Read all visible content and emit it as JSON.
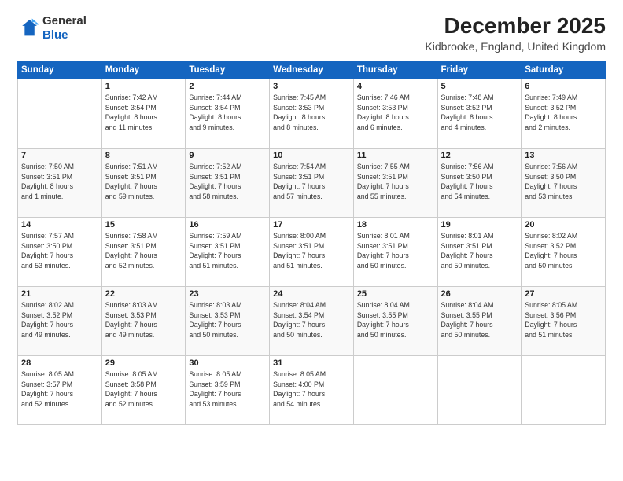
{
  "logo": {
    "general": "General",
    "blue": "Blue"
  },
  "title": "December 2025",
  "location": "Kidbrooke, England, United Kingdom",
  "days_of_week": [
    "Sunday",
    "Monday",
    "Tuesday",
    "Wednesday",
    "Thursday",
    "Friday",
    "Saturday"
  ],
  "weeks": [
    [
      {
        "date": "",
        "info": ""
      },
      {
        "date": "1",
        "info": "Sunrise: 7:42 AM\nSunset: 3:54 PM\nDaylight: 8 hours\nand 11 minutes."
      },
      {
        "date": "2",
        "info": "Sunrise: 7:44 AM\nSunset: 3:54 PM\nDaylight: 8 hours\nand 9 minutes."
      },
      {
        "date": "3",
        "info": "Sunrise: 7:45 AM\nSunset: 3:53 PM\nDaylight: 8 hours\nand 8 minutes."
      },
      {
        "date": "4",
        "info": "Sunrise: 7:46 AM\nSunset: 3:53 PM\nDaylight: 8 hours\nand 6 minutes."
      },
      {
        "date": "5",
        "info": "Sunrise: 7:48 AM\nSunset: 3:52 PM\nDaylight: 8 hours\nand 4 minutes."
      },
      {
        "date": "6",
        "info": "Sunrise: 7:49 AM\nSunset: 3:52 PM\nDaylight: 8 hours\nand 2 minutes."
      }
    ],
    [
      {
        "date": "7",
        "info": "Sunrise: 7:50 AM\nSunset: 3:51 PM\nDaylight: 8 hours\nand 1 minute."
      },
      {
        "date": "8",
        "info": "Sunrise: 7:51 AM\nSunset: 3:51 PM\nDaylight: 7 hours\nand 59 minutes."
      },
      {
        "date": "9",
        "info": "Sunrise: 7:52 AM\nSunset: 3:51 PM\nDaylight: 7 hours\nand 58 minutes."
      },
      {
        "date": "10",
        "info": "Sunrise: 7:54 AM\nSunset: 3:51 PM\nDaylight: 7 hours\nand 57 minutes."
      },
      {
        "date": "11",
        "info": "Sunrise: 7:55 AM\nSunset: 3:51 PM\nDaylight: 7 hours\nand 55 minutes."
      },
      {
        "date": "12",
        "info": "Sunrise: 7:56 AM\nSunset: 3:50 PM\nDaylight: 7 hours\nand 54 minutes."
      },
      {
        "date": "13",
        "info": "Sunrise: 7:56 AM\nSunset: 3:50 PM\nDaylight: 7 hours\nand 53 minutes."
      }
    ],
    [
      {
        "date": "14",
        "info": "Sunrise: 7:57 AM\nSunset: 3:50 PM\nDaylight: 7 hours\nand 53 minutes."
      },
      {
        "date": "15",
        "info": "Sunrise: 7:58 AM\nSunset: 3:51 PM\nDaylight: 7 hours\nand 52 minutes."
      },
      {
        "date": "16",
        "info": "Sunrise: 7:59 AM\nSunset: 3:51 PM\nDaylight: 7 hours\nand 51 minutes."
      },
      {
        "date": "17",
        "info": "Sunrise: 8:00 AM\nSunset: 3:51 PM\nDaylight: 7 hours\nand 51 minutes."
      },
      {
        "date": "18",
        "info": "Sunrise: 8:01 AM\nSunset: 3:51 PM\nDaylight: 7 hours\nand 50 minutes."
      },
      {
        "date": "19",
        "info": "Sunrise: 8:01 AM\nSunset: 3:51 PM\nDaylight: 7 hours\nand 50 minutes."
      },
      {
        "date": "20",
        "info": "Sunrise: 8:02 AM\nSunset: 3:52 PM\nDaylight: 7 hours\nand 50 minutes."
      }
    ],
    [
      {
        "date": "21",
        "info": "Sunrise: 8:02 AM\nSunset: 3:52 PM\nDaylight: 7 hours\nand 49 minutes."
      },
      {
        "date": "22",
        "info": "Sunrise: 8:03 AM\nSunset: 3:53 PM\nDaylight: 7 hours\nand 49 minutes."
      },
      {
        "date": "23",
        "info": "Sunrise: 8:03 AM\nSunset: 3:53 PM\nDaylight: 7 hours\nand 50 minutes."
      },
      {
        "date": "24",
        "info": "Sunrise: 8:04 AM\nSunset: 3:54 PM\nDaylight: 7 hours\nand 50 minutes."
      },
      {
        "date": "25",
        "info": "Sunrise: 8:04 AM\nSunset: 3:55 PM\nDaylight: 7 hours\nand 50 minutes."
      },
      {
        "date": "26",
        "info": "Sunrise: 8:04 AM\nSunset: 3:55 PM\nDaylight: 7 hours\nand 50 minutes."
      },
      {
        "date": "27",
        "info": "Sunrise: 8:05 AM\nSunset: 3:56 PM\nDaylight: 7 hours\nand 51 minutes."
      }
    ],
    [
      {
        "date": "28",
        "info": "Sunrise: 8:05 AM\nSunset: 3:57 PM\nDaylight: 7 hours\nand 52 minutes."
      },
      {
        "date": "29",
        "info": "Sunrise: 8:05 AM\nSunset: 3:58 PM\nDaylight: 7 hours\nand 52 minutes."
      },
      {
        "date": "30",
        "info": "Sunrise: 8:05 AM\nSunset: 3:59 PM\nDaylight: 7 hours\nand 53 minutes."
      },
      {
        "date": "31",
        "info": "Sunrise: 8:05 AM\nSunset: 4:00 PM\nDaylight: 7 hours\nand 54 minutes."
      },
      {
        "date": "",
        "info": ""
      },
      {
        "date": "",
        "info": ""
      },
      {
        "date": "",
        "info": ""
      }
    ]
  ]
}
